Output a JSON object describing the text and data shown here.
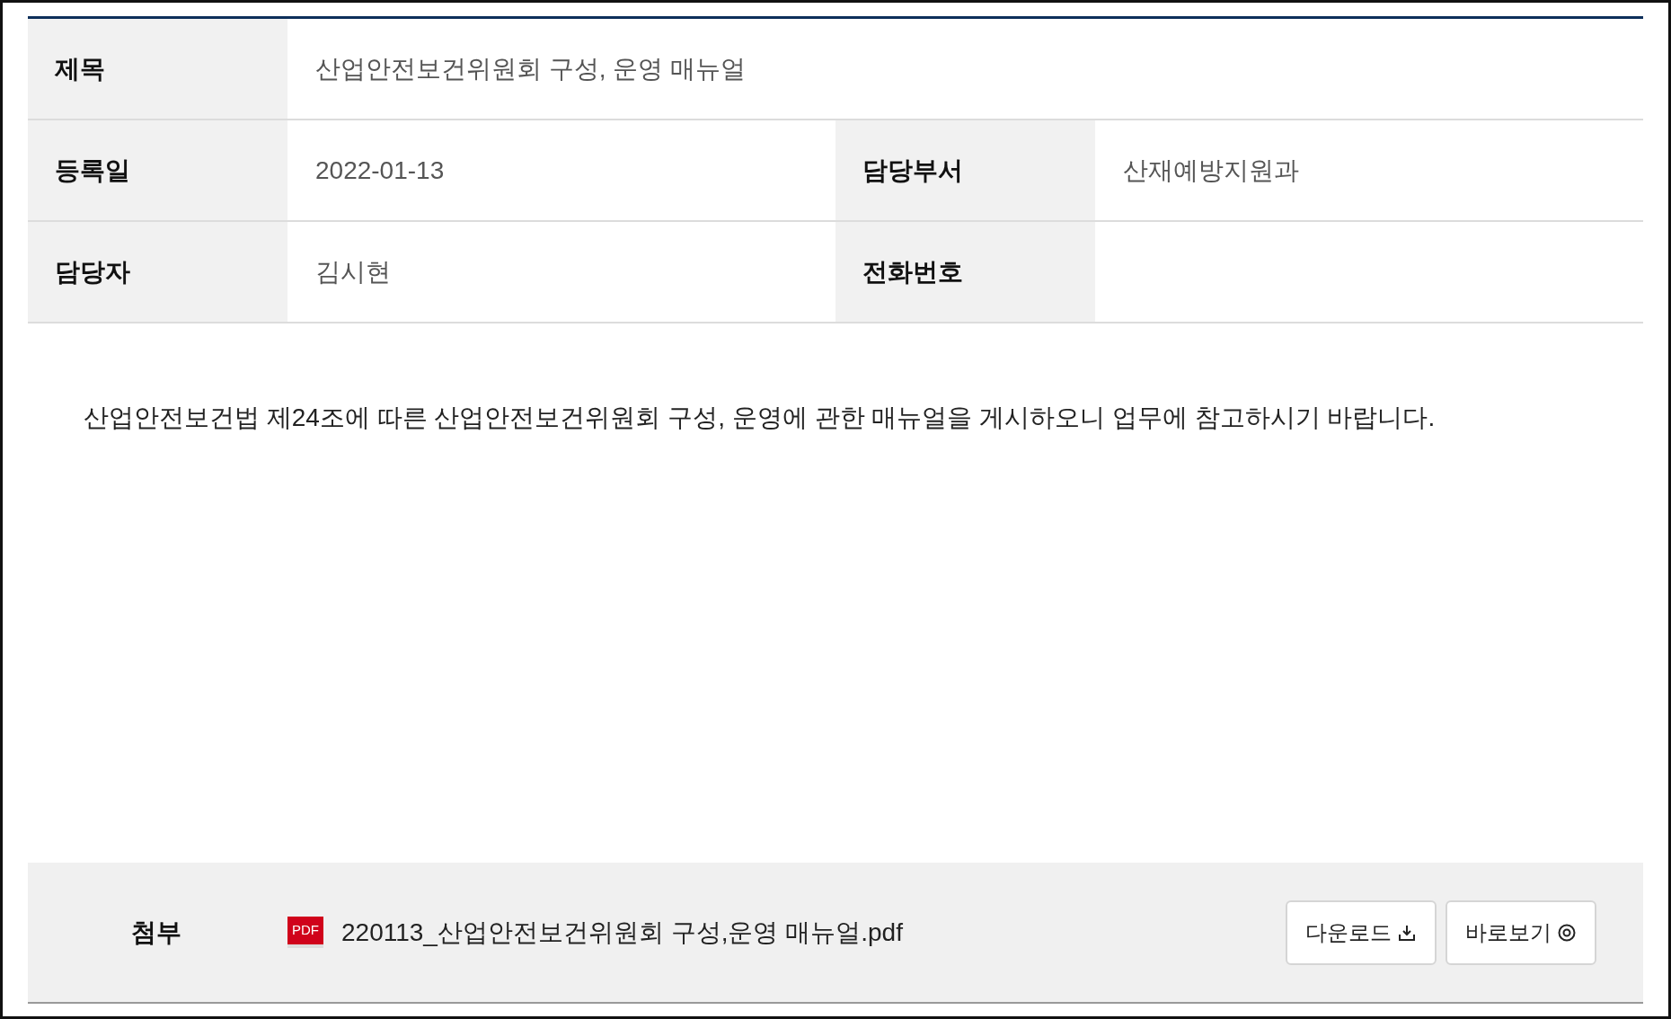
{
  "info_rows": [
    {
      "cells": [
        {
          "label": "제목",
          "value": "산업안전보건위원회 구성, 운영 매뉴얼"
        }
      ]
    },
    {
      "cells": [
        {
          "label": "등록일",
          "value": "2022-01-13"
        },
        {
          "label": "담당부서",
          "value": "산재예방지원과"
        }
      ]
    },
    {
      "cells": [
        {
          "label": "담당자",
          "value": "김시현"
        },
        {
          "label": "전화번호"
        }
      ]
    }
  ],
  "body": "산업안전보건법 제24조에 따른 산업안전보건위원회 구성, 운영에 관한 매뉴얼을 게시하오니 업무에 참고하시기 바랍니다.",
  "attachment": {
    "label": "첨부",
    "file_badge": "PDF",
    "file_name": "220113_산업안전보건위원회 구성,운영 매뉴얼.pdf",
    "buttons": [
      {
        "label": "다운로드",
        "kind": "download"
      },
      {
        "label": "바로보기",
        "kind": "view"
      }
    ]
  }
}
